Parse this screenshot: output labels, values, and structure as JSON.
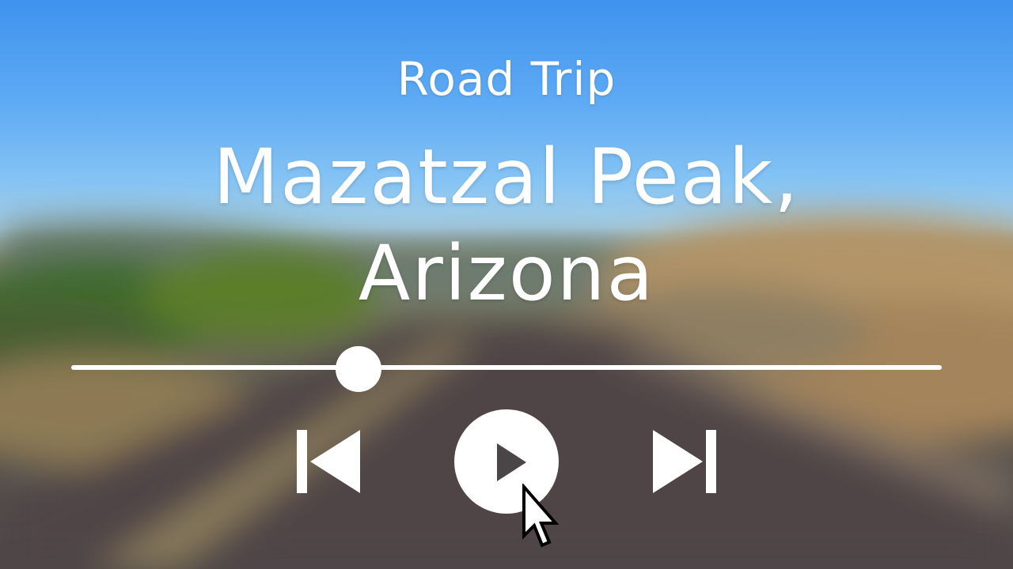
{
  "video": {
    "title_small": "Road Trip",
    "title_line1": "Mazatzal Peak,",
    "title_line2": "Arizona"
  },
  "player": {
    "progress_fraction": 0.33,
    "accent_color": "#ffffff"
  },
  "icons": {
    "previous": "skip-previous-icon",
    "play": "play-icon",
    "next": "skip-next-icon",
    "cursor": "mouse-pointer-icon"
  }
}
